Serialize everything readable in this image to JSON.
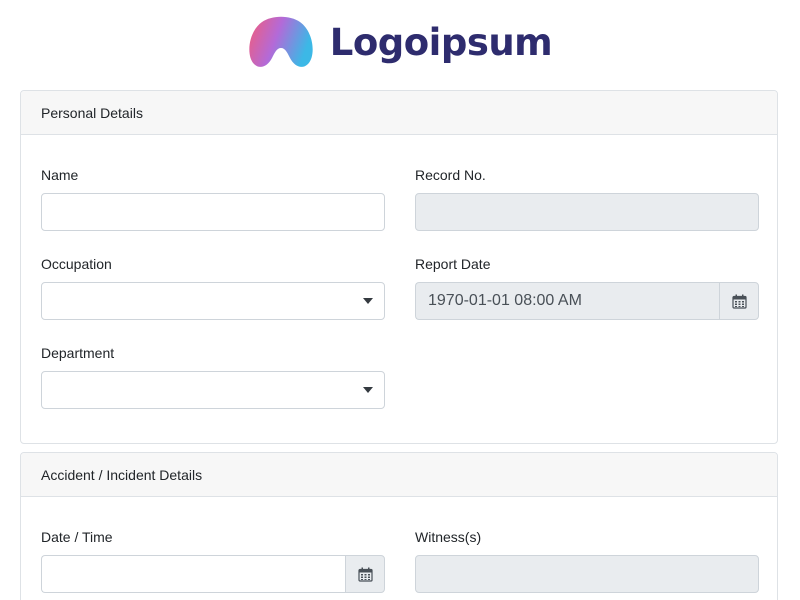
{
  "brand": {
    "name": "Logoipsum"
  },
  "sections": {
    "personal": {
      "title": "Personal Details",
      "name_label": "Name",
      "name_value": "",
      "record_label": "Record No.",
      "record_value": "",
      "occupation_label": "Occupation",
      "occupation_value": "",
      "report_date_label": "Report Date",
      "report_date_value": "1970-01-01 08:00 AM",
      "department_label": "Department",
      "department_value": ""
    },
    "incident": {
      "title": "Accident / Incident Details",
      "datetime_label": "Date / Time",
      "datetime_value": "",
      "witness_label": "Witness(s)",
      "witness_value": ""
    }
  },
  "icons": {
    "calendar": "calendar-icon",
    "dropdown": "chevron-down-icon"
  },
  "colors": {
    "brand_text": "#2e2c6e",
    "brand_gradient_start": "#f25c7a",
    "brand_gradient_mid": "#b36ad8",
    "brand_gradient_end": "#3cb8e6",
    "disabled_bg": "#e9ecef",
    "header_bg": "#f7f7f7"
  }
}
